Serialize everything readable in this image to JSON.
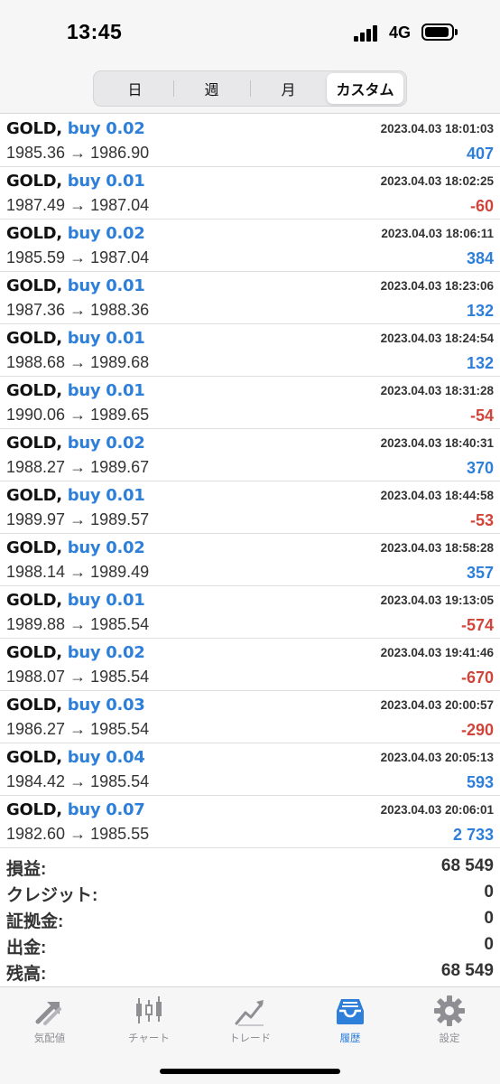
{
  "status": {
    "time": "13:45",
    "network": "4G"
  },
  "segments": [
    "日",
    "週",
    "月",
    "カスタム"
  ],
  "active_segment": "カスタム",
  "trades": [
    {
      "symbol": "GOLD,",
      "side": "buy 0.02",
      "open": "1985.36",
      "arrow": "→",
      "close": "1986.90",
      "datetime": "2023.04.03 18:01:03",
      "profit": "407",
      "sign": "pos"
    },
    {
      "symbol": "GOLD,",
      "side": "buy 0.01",
      "open": "1987.49",
      "arrow": "→",
      "close": "1987.04",
      "datetime": "2023.04.03 18:02:25",
      "profit": "-60",
      "sign": "neg"
    },
    {
      "symbol": "GOLD,",
      "side": "buy 0.02",
      "open": "1985.59",
      "arrow": "→",
      "close": "1987.04",
      "datetime": "2023.04.03 18:06:11",
      "profit": "384",
      "sign": "pos"
    },
    {
      "symbol": "GOLD,",
      "side": "buy 0.01",
      "open": "1987.36",
      "arrow": "→",
      "close": "1988.36",
      "datetime": "2023.04.03 18:23:06",
      "profit": "132",
      "sign": "pos"
    },
    {
      "symbol": "GOLD,",
      "side": "buy 0.01",
      "open": "1988.68",
      "arrow": "→",
      "close": "1989.68",
      "datetime": "2023.04.03 18:24:54",
      "profit": "132",
      "sign": "pos"
    },
    {
      "symbol": "GOLD,",
      "side": "buy 0.01",
      "open": "1990.06",
      "arrow": "→",
      "close": "1989.65",
      "datetime": "2023.04.03 18:31:28",
      "profit": "-54",
      "sign": "neg"
    },
    {
      "symbol": "GOLD,",
      "side": "buy 0.02",
      "open": "1988.27",
      "arrow": "→",
      "close": "1989.67",
      "datetime": "2023.04.03 18:40:31",
      "profit": "370",
      "sign": "pos"
    },
    {
      "symbol": "GOLD,",
      "side": "buy 0.01",
      "open": "1989.97",
      "arrow": "→",
      "close": "1989.57",
      "datetime": "2023.04.03 18:44:58",
      "profit": "-53",
      "sign": "neg"
    },
    {
      "symbol": "GOLD,",
      "side": "buy 0.02",
      "open": "1988.14",
      "arrow": "→",
      "close": "1989.49",
      "datetime": "2023.04.03 18:58:28",
      "profit": "357",
      "sign": "pos"
    },
    {
      "symbol": "GOLD,",
      "side": "buy 0.01",
      "open": "1989.88",
      "arrow": "→",
      "close": "1985.54",
      "datetime": "2023.04.03 19:13:05",
      "profit": "-574",
      "sign": "neg"
    },
    {
      "symbol": "GOLD,",
      "side": "buy 0.02",
      "open": "1988.07",
      "arrow": "→",
      "close": "1985.54",
      "datetime": "2023.04.03 19:41:46",
      "profit": "-670",
      "sign": "neg"
    },
    {
      "symbol": "GOLD,",
      "side": "buy 0.03",
      "open": "1986.27",
      "arrow": "→",
      "close": "1985.54",
      "datetime": "2023.04.03 20:00:57",
      "profit": "-290",
      "sign": "neg"
    },
    {
      "symbol": "GOLD,",
      "side": "buy 0.04",
      "open": "1984.42",
      "arrow": "→",
      "close": "1985.54",
      "datetime": "2023.04.03 20:05:13",
      "profit": "593",
      "sign": "pos"
    },
    {
      "symbol": "GOLD,",
      "side": "buy 0.07",
      "open": "1982.60",
      "arrow": "→",
      "close": "1985.55",
      "datetime": "2023.04.03 20:06:01",
      "profit": "2 733",
      "sign": "pos"
    }
  ],
  "summary": [
    {
      "label": "損益:",
      "value": "68 549"
    },
    {
      "label": "クレジット:",
      "value": "0"
    },
    {
      "label": "証拠金:",
      "value": "0"
    },
    {
      "label": "出金:",
      "value": "0"
    },
    {
      "label": "残高:",
      "value": "68 549"
    }
  ],
  "tabs": [
    {
      "label": "気配値",
      "icon": "quotes-arrows-icon"
    },
    {
      "label": "チャート",
      "icon": "candlestick-chart-icon"
    },
    {
      "label": "トレード",
      "icon": "trade-chart-icon"
    },
    {
      "label": "履歴",
      "icon": "history-inbox-icon"
    },
    {
      "label": "設定",
      "icon": "gear-icon"
    }
  ],
  "active_tab": "履歴",
  "colors": {
    "accent": "#2e7fd9",
    "negative": "#d0453a",
    "inactive": "#8e8e93"
  }
}
